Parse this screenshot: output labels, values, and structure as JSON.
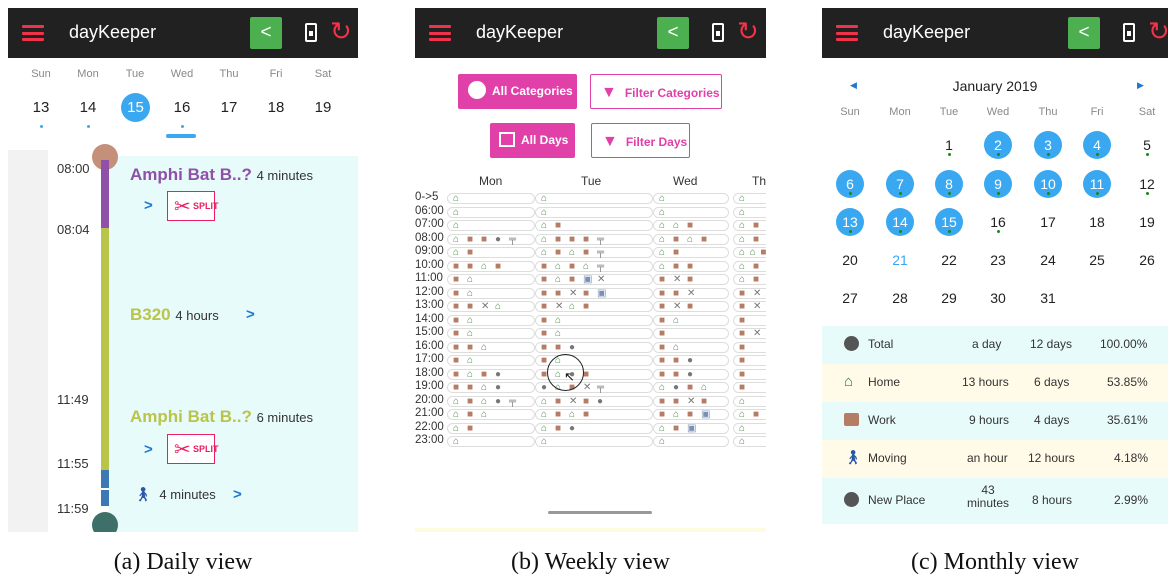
{
  "app": {
    "title": "dayKeeper"
  },
  "colors": {
    "accent": "#3aa8f0",
    "magenta": "#e040a8",
    "bar": "#212121",
    "red": "#f0324a",
    "green": "#4caf50"
  },
  "captions": [
    "(a) Daily view",
    "(b) Weekly view",
    "(c) Monthly view"
  ],
  "daily": {
    "weekdays": [
      "Sun",
      "Mon",
      "Tue",
      "Wed",
      "Thu",
      "Fri",
      "Sat"
    ],
    "dates": [
      "13",
      "14",
      "15",
      "16",
      "17",
      "18",
      "19"
    ],
    "selected_date": "15",
    "times": [
      "08:00",
      "08:04",
      "11:49",
      "11:55",
      "11:59"
    ],
    "entries": [
      {
        "name": "Amphi Bat B..?",
        "duration": "4 minutes"
      },
      {
        "name": "B320",
        "duration": "4 hours"
      },
      {
        "name": "Amphi Bat B..?",
        "duration": "6 minutes"
      },
      {
        "name": "",
        "duration": "4 minutes"
      }
    ],
    "split_label": "SPLIT"
  },
  "weekly": {
    "buttons": {
      "all_categories": "All Categories",
      "filter_categories": "Filter Categories",
      "all_days": "All Days",
      "filter_days": "Filter Days"
    },
    "days": [
      "Mon",
      "Tue",
      "Wed",
      "Th"
    ],
    "hours": [
      "0->5",
      "06:00",
      "07:00",
      "08:00",
      "09:00",
      "10:00",
      "11:00",
      "12:00",
      "13:00",
      "14:00",
      "15:00",
      "16:00",
      "17:00",
      "18:00",
      "19:00",
      "20:00",
      "21:00",
      "22:00",
      "23:00"
    ]
  },
  "monthly": {
    "month_label": "January 2019",
    "weekdays": [
      "Sun",
      "Mon",
      "Tue",
      "Wed",
      "Thu",
      "Fri",
      "Sat"
    ],
    "weeks": [
      [
        "",
        "",
        "",
        "1",
        "2",
        "3",
        "4",
        "5"
      ],
      [
        "6",
        "7",
        "8",
        "9",
        "10",
        "11",
        "12"
      ],
      [
        "13",
        "14",
        "15",
        "16",
        "17",
        "18",
        "19"
      ],
      [
        "20",
        "21",
        "22",
        "23",
        "24",
        "25",
        "26"
      ],
      [
        "27",
        "28",
        "29",
        "30",
        "31",
        "",
        ""
      ]
    ],
    "summary": [
      {
        "category": "Total",
        "duration": "a day",
        "days": "12 days",
        "percent": "100.00%",
        "icon": "compass-icon"
      },
      {
        "category": "Home",
        "duration": "13 hours",
        "days": "6 days",
        "percent": "53.85%",
        "icon": "home-icon"
      },
      {
        "category": "Work",
        "duration": "9 hours",
        "days": "4 days",
        "percent": "35.61%",
        "icon": "briefcase-icon"
      },
      {
        "category": "Moving",
        "duration": "an hour",
        "days": "12 hours",
        "percent": "4.18%",
        "icon": "walking-icon"
      },
      {
        "category": "New Place",
        "duration": "43 minutes",
        "days": "8 hours",
        "percent": "2.99%",
        "icon": "compass-icon"
      }
    ]
  }
}
